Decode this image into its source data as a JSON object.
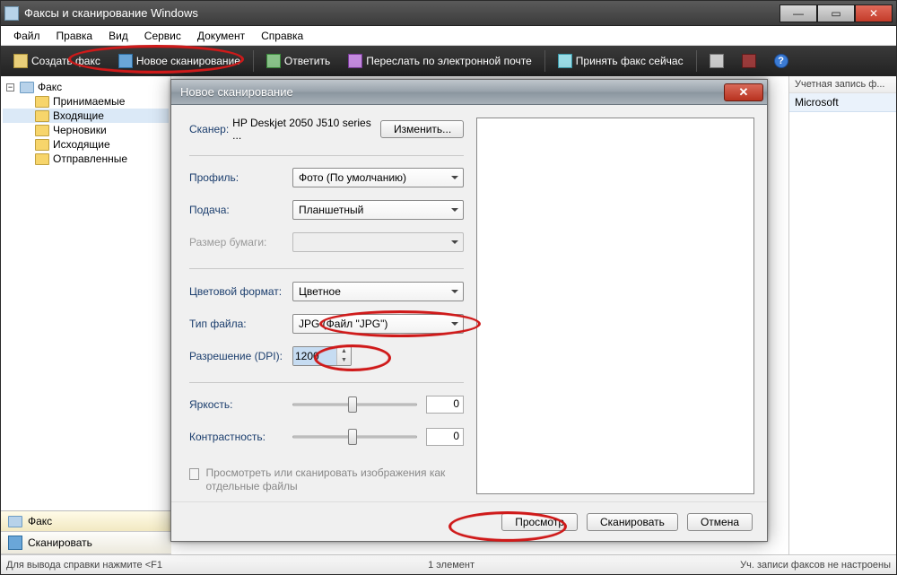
{
  "window": {
    "title": "Факсы и сканирование Windows",
    "min": "—",
    "max": "▭",
    "close": "✕"
  },
  "menu": {
    "file": "Файл",
    "edit": "Правка",
    "view": "Вид",
    "service": "Сервис",
    "document": "Документ",
    "help": "Справка"
  },
  "toolbar": {
    "createFax": "Создать факс",
    "newScan": "Новое сканирование",
    "reply": "Ответить",
    "forward": "Переслать по электронной почте",
    "receiveFax": "Принять факс сейчас"
  },
  "tree": {
    "root": "Факс",
    "items": [
      "Принимаемые",
      "Входящие",
      "Черновики",
      "Исходящие",
      "Отправленные"
    ]
  },
  "rightcol": {
    "header": "Учетная запись ф...",
    "value": "Microsoft"
  },
  "leftBottom": {
    "fax": "Факс",
    "scan": "Сканировать"
  },
  "status": {
    "help": "Для вывода справки нажмите <F1",
    "count": "1 элемент",
    "accounts": "Уч. записи факсов не настроены"
  },
  "dialog": {
    "title": "Новое сканирование",
    "scannerLabel": "Сканер:",
    "scannerName": "HP Deskjet 2050 J510 series ...",
    "changeBtn": "Изменить...",
    "profileLabel": "Профиль:",
    "profileValue": "Фото (По умолчанию)",
    "sourceLabel": "Подача:",
    "sourceValue": "Планшетный",
    "paperLabel": "Размер бумаги:",
    "colorLabel": "Цветовой формат:",
    "colorValue": "Цветное",
    "typeLabel": "Тип файла:",
    "typeValue": "JPG (Файл \"JPG\")",
    "dpiLabel": "Разрешение (DPI):",
    "dpiValue": "1200",
    "brightLabel": "Яркость:",
    "brightValue": "0",
    "contrastLabel": "Контрастность:",
    "contrastValue": "0",
    "checkboxText": "Просмотреть или сканировать изображения как отдельные файлы",
    "preview": "Просмотр",
    "scan": "Сканировать",
    "cancel": "Отмена",
    "close": "✕"
  }
}
